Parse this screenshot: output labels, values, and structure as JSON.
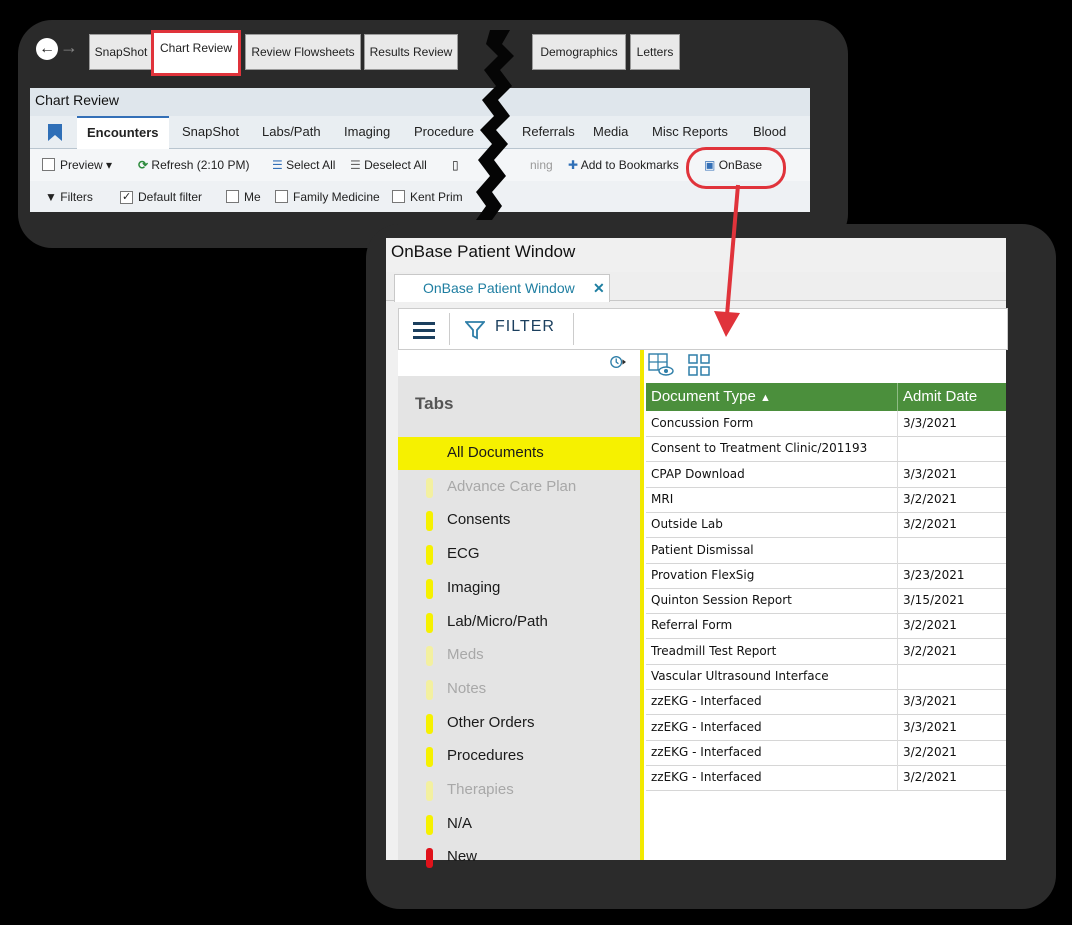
{
  "epic": {
    "main_tabs": [
      "SnapShot",
      "Chart Review",
      "Review Flowsheets",
      "Results Review",
      "Demographics",
      "Letters"
    ],
    "section_title": "Chart Review",
    "sub_tabs": [
      "Encounters",
      "SnapShot",
      "Labs/Path",
      "Imaging",
      "Procedure",
      "Referrals",
      "Media",
      "Misc Reports",
      "Blood"
    ],
    "toolbar": {
      "preview": "Preview",
      "refresh": "Refresh (2:10 PM)",
      "select_all": "Select All",
      "deselect_all": "Deselect All",
      "routing": "ning",
      "add_bookmarks": "Add to Bookmarks",
      "onbase": "OnBase"
    },
    "filters": {
      "filters": "Filters",
      "default_filter": "Default filter",
      "me": "Me",
      "family_medicine": "Family Medicine",
      "kent": "Kent Prim"
    }
  },
  "onbase": {
    "window_title": "OnBase Patient Window",
    "tab_label": "OnBase Patient Window",
    "tab_close": "✕",
    "filter_label": "FILTER",
    "tabs_heading": "Tabs",
    "side_items": [
      {
        "label": "All Documents",
        "color": "#f6f100",
        "state": "selected"
      },
      {
        "label": "Advance Care Plan",
        "color": "#f3f0a0",
        "state": "dim"
      },
      {
        "label": "Consents",
        "color": "#f6f100",
        "state": "normal"
      },
      {
        "label": "ECG",
        "color": "#f6f100",
        "state": "normal"
      },
      {
        "label": "Imaging",
        "color": "#f6f100",
        "state": "normal"
      },
      {
        "label": "Lab/Micro/Path",
        "color": "#f6f100",
        "state": "normal"
      },
      {
        "label": "Meds",
        "color": "#f3f0a0",
        "state": "dim"
      },
      {
        "label": "Notes",
        "color": "#f3f0a0",
        "state": "dim"
      },
      {
        "label": "Other Orders",
        "color": "#f6f100",
        "state": "normal"
      },
      {
        "label": "Procedures",
        "color": "#f6f100",
        "state": "normal"
      },
      {
        "label": "Therapies",
        "color": "#f3f0a0",
        "state": "dim"
      },
      {
        "label": "N/A",
        "color": "#f6f100",
        "state": "normal"
      },
      {
        "label": "New",
        "color": "#e0121b",
        "state": "normal"
      }
    ],
    "columns": {
      "doc_type": "Document Type",
      "sort": "▲",
      "admit_date": "Admit Date"
    },
    "rows": [
      {
        "type": "Concussion Form",
        "date": "3/3/2021"
      },
      {
        "type": "Consent to Treatment Clinic/201193",
        "date": ""
      },
      {
        "type": "CPAP Download",
        "date": "3/3/2021"
      },
      {
        "type": "MRI",
        "date": "3/2/2021"
      },
      {
        "type": "Outside Lab",
        "date": "3/2/2021"
      },
      {
        "type": "Patient Dismissal",
        "date": ""
      },
      {
        "type": "Provation FlexSig",
        "date": "3/23/2021"
      },
      {
        "type": "Quinton Session Report",
        "date": "3/15/2021"
      },
      {
        "type": "Referral Form",
        "date": "3/2/2021"
      },
      {
        "type": "Treadmill Test Report",
        "date": "3/2/2021"
      },
      {
        "type": "Vascular Ultrasound Interface",
        "date": ""
      },
      {
        "type": "zzEKG - Interfaced",
        "date": "3/3/2021"
      },
      {
        "type": "zzEKG - Interfaced",
        "date": "3/3/2021"
      },
      {
        "type": "zzEKG - Interfaced",
        "date": "3/2/2021"
      },
      {
        "type": "zzEKG - Interfaced",
        "date": "3/2/2021"
      }
    ]
  },
  "colors": {
    "highlight": "#e0333b",
    "grid_header": "#4b8f3c",
    "yellow": "#f6f100"
  }
}
